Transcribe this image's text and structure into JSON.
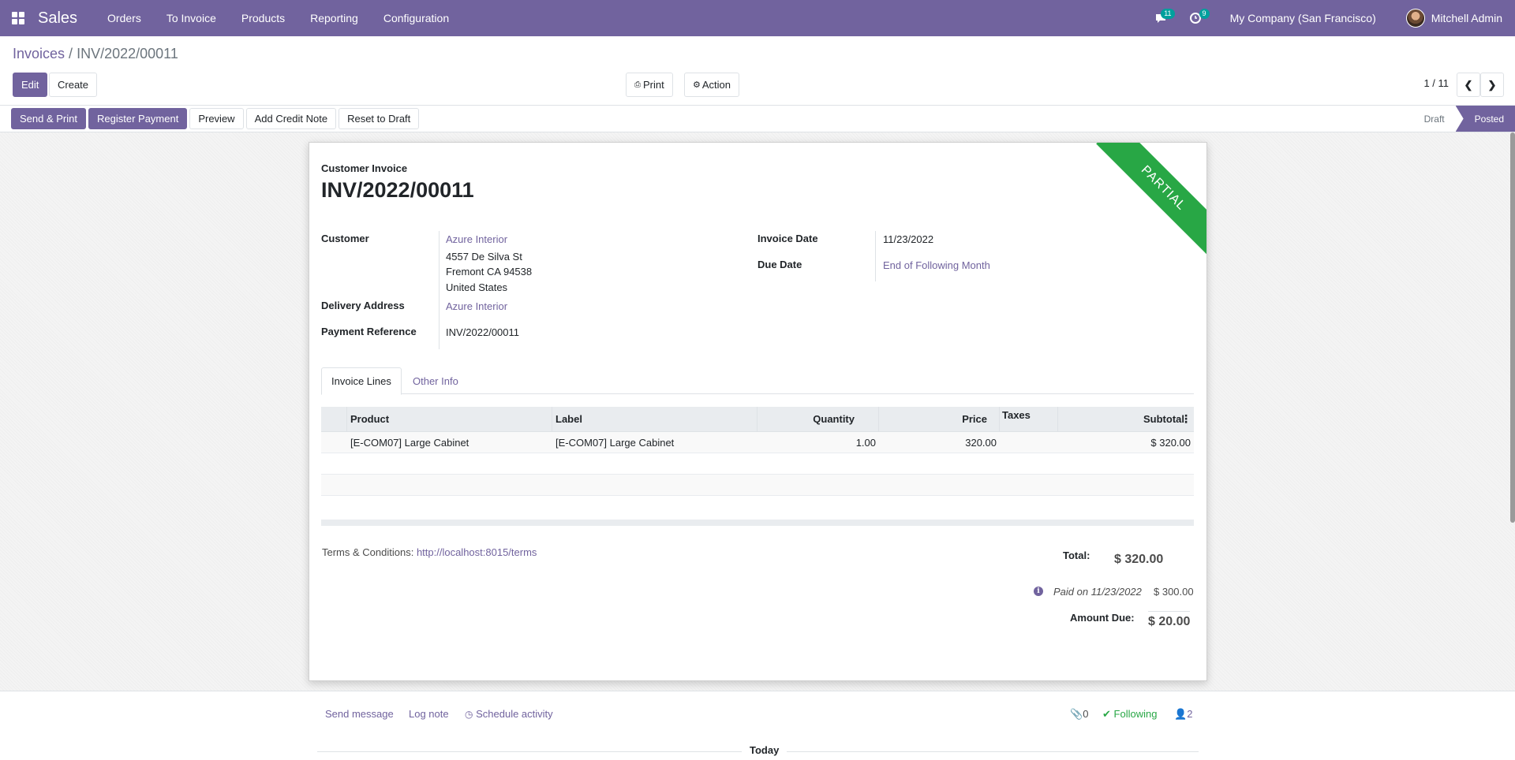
{
  "navbar": {
    "app_name": "Sales",
    "menu": [
      "Orders",
      "To Invoice",
      "Products",
      "Reporting",
      "Configuration"
    ],
    "messages_count": "11",
    "activities_count": "9",
    "company": "My Company (San Francisco)",
    "user": "Mitchell Admin",
    "color": "#71639e"
  },
  "control": {
    "breadcrumb_parent": "Invoices",
    "breadcrumb_sep": " / ",
    "breadcrumb_current": "INV/2022/00011",
    "edit_label": "Edit",
    "create_label": "Create",
    "print_label": "Print",
    "action_label": "Action",
    "pager": "1 / 11"
  },
  "statusbar": {
    "buttons": [
      "Send & Print",
      "Register Payment",
      "Preview",
      "Add Credit Note",
      "Reset to Draft"
    ],
    "stages": [
      "Draft",
      "Posted"
    ],
    "active_stage": "Posted"
  },
  "invoice": {
    "kind": "Customer Invoice",
    "number": "INV/2022/00011",
    "ribbon": "PARTIAL",
    "ribbon_color": "#28a745",
    "customer_label": "Customer",
    "customer_name": "Azure Interior",
    "address_line1": "4557 De Silva St",
    "address_line2": "Fremont CA 94538",
    "address_line3": "United States",
    "delivery_label": "Delivery Address",
    "delivery_value": "Azure Interior",
    "payref_label": "Payment Reference",
    "payref_value": "INV/2022/00011",
    "invoice_date_label": "Invoice Date",
    "invoice_date": "11/23/2022",
    "due_date_label": "Due Date",
    "due_date": "End of Following Month"
  },
  "tabs": [
    "Invoice Lines",
    "Other Info"
  ],
  "lines": {
    "headers": {
      "product": "Product",
      "label": "Label",
      "quantity": "Quantity",
      "price": "Price",
      "taxes": "Taxes",
      "subtotal": "Subtotal"
    },
    "rows": [
      {
        "product": "[E-COM07] Large Cabinet",
        "label": "[E-COM07] Large Cabinet",
        "quantity": "1.00",
        "price": "320.00",
        "taxes": "",
        "subtotal": "$ 320.00"
      }
    ]
  },
  "footer": {
    "terms_label": "Terms & Conditions: ",
    "terms_link": "http://localhost:8015/terms",
    "total_label": "Total:",
    "total_value": "$ 320.00",
    "paid_text": "Paid on 11/23/2022",
    "paid_amount": "$ 300.00",
    "due_label": "Amount Due:",
    "due_value": "$ 20.00"
  },
  "chatter": {
    "send_message": "Send message",
    "log_note": "Log note",
    "schedule_activity": "Schedule activity",
    "attachments": "0",
    "following": "Following",
    "followers": "2",
    "today": "Today"
  }
}
